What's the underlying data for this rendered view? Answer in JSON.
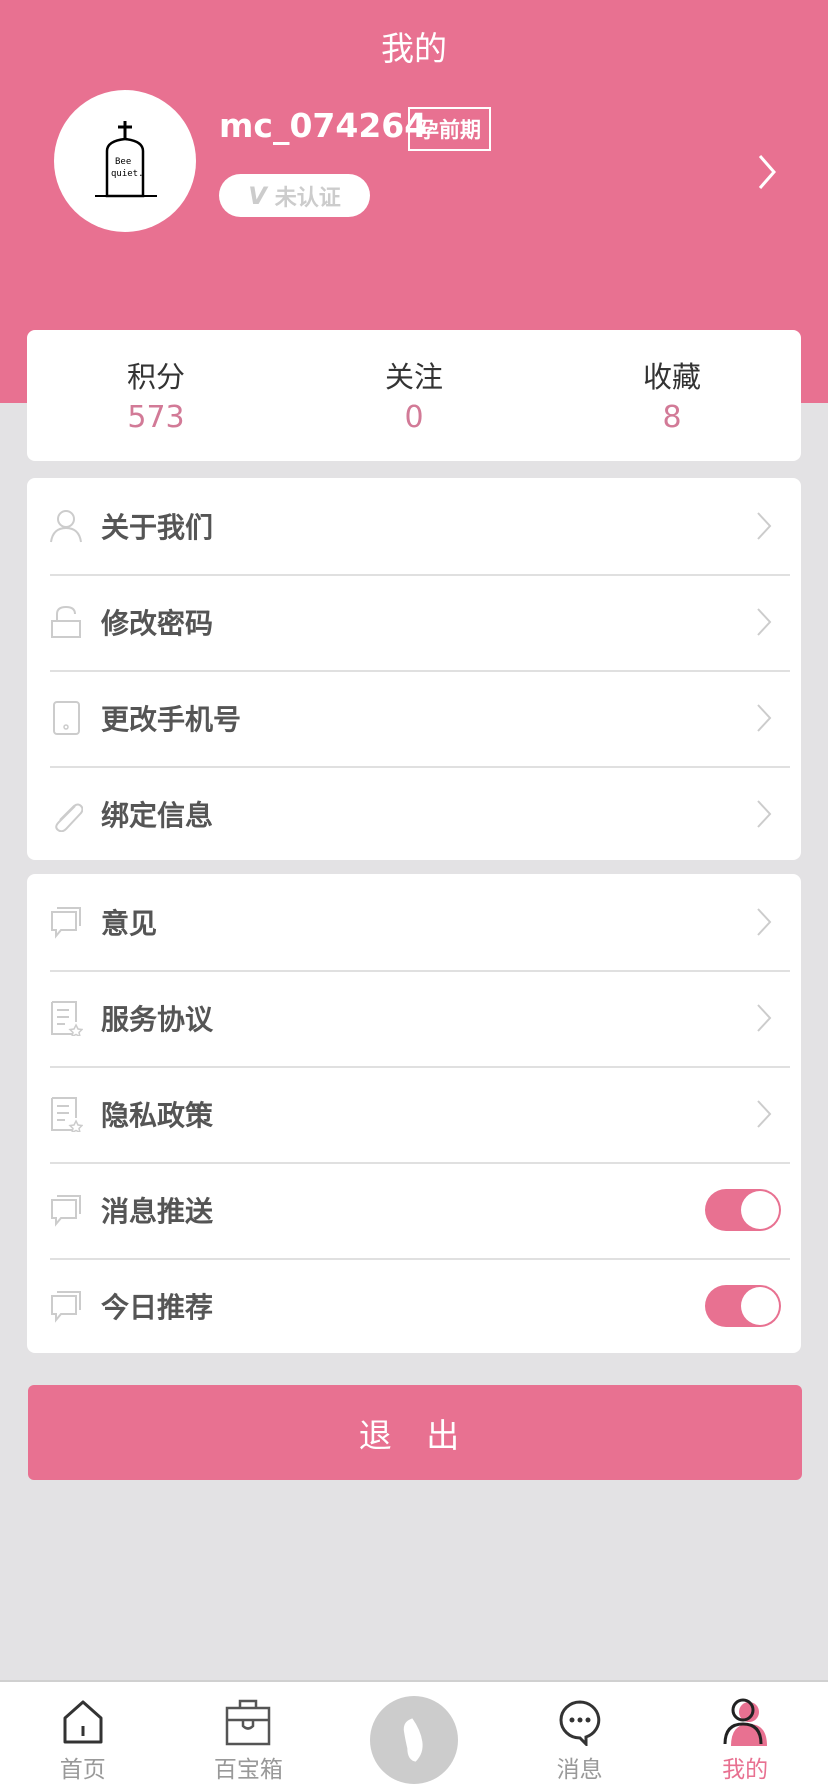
{
  "header": {
    "title": "我的",
    "username": "mc_074264",
    "stage_badge": "孕前期",
    "verify_status": "未认证",
    "accent": "#e87191"
  },
  "stats": [
    {
      "label": "积分",
      "value": "573"
    },
    {
      "label": "关注",
      "value": "0"
    },
    {
      "label": "收藏",
      "value": "8"
    }
  ],
  "menu1": [
    {
      "label": "关于我们",
      "icon": "user-icon"
    },
    {
      "label": "修改密码",
      "icon": "lock-icon"
    },
    {
      "label": "更改手机号",
      "icon": "phone-icon"
    },
    {
      "label": "绑定信息",
      "icon": "paperclip-icon"
    }
  ],
  "menu2": [
    {
      "label": "意见",
      "icon": "comment-icon"
    },
    {
      "label": "服务协议",
      "icon": "document-icon"
    },
    {
      "label": "隐私政策",
      "icon": "document-icon"
    },
    {
      "label": "消息推送",
      "icon": "comment-icon",
      "toggle": true
    },
    {
      "label": "今日推荐",
      "icon": "comment-icon",
      "toggle": true
    }
  ],
  "logout_label": "退 出",
  "nav": [
    {
      "label": "首页",
      "icon": "home-icon"
    },
    {
      "label": "百宝箱",
      "icon": "toolbox-icon"
    },
    {
      "label": "",
      "icon": "baby-icon"
    },
    {
      "label": "消息",
      "icon": "message-icon"
    },
    {
      "label": "我的",
      "icon": "profile-icon",
      "active": true
    }
  ]
}
